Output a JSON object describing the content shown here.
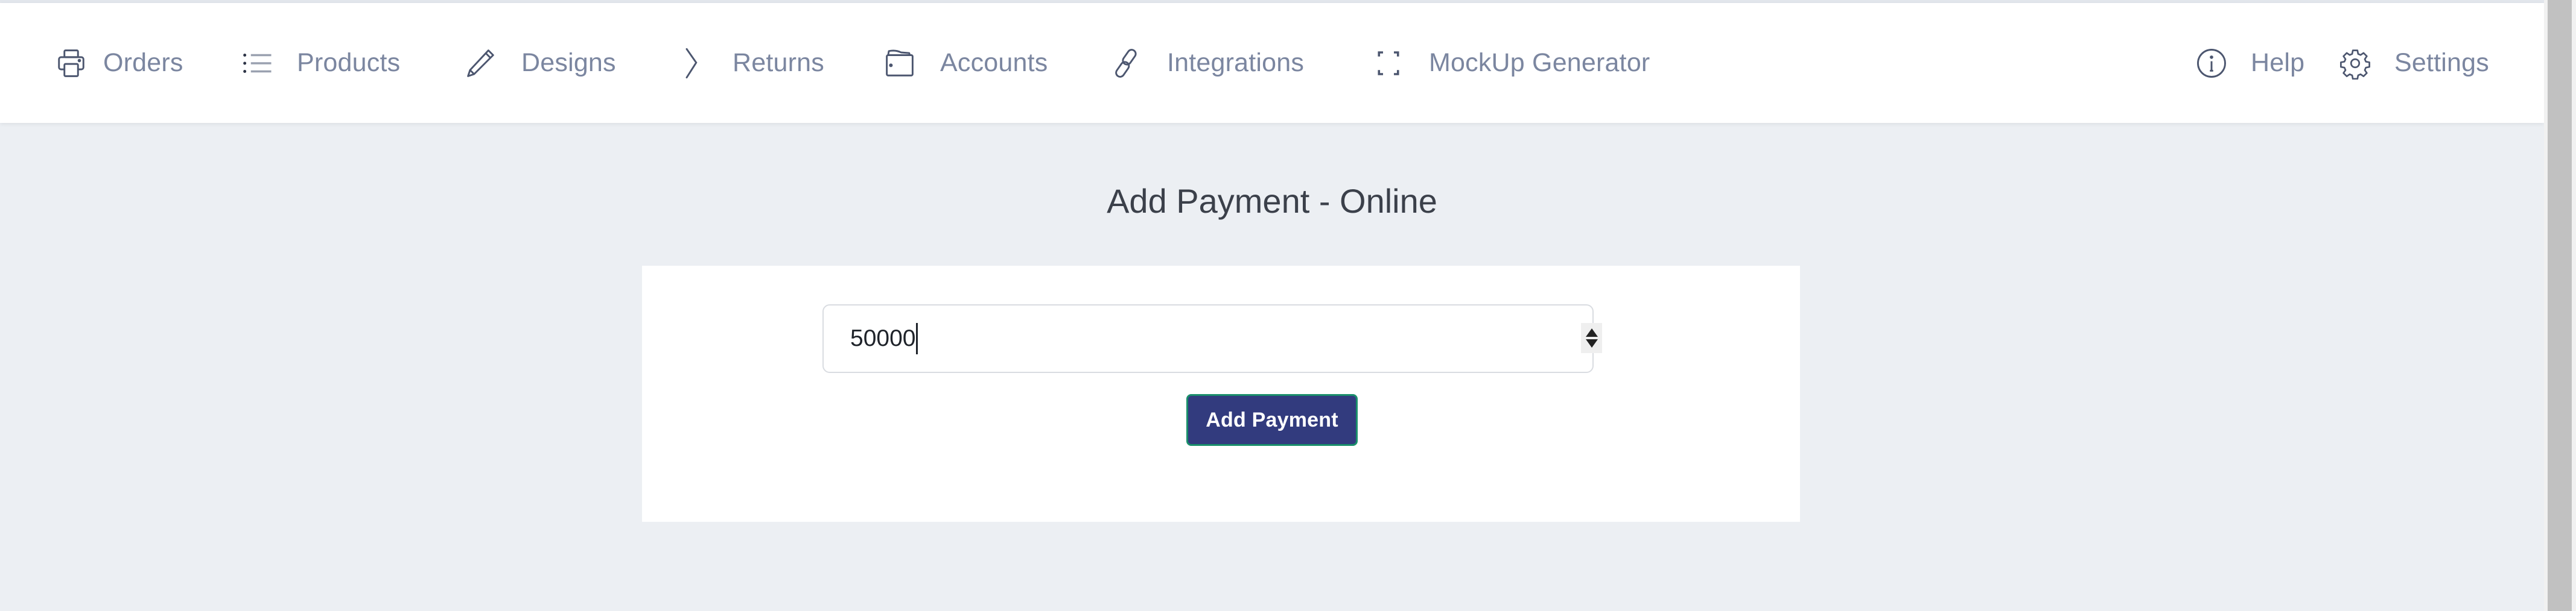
{
  "nav": {
    "left_items": [
      {
        "label": "Orders",
        "icon": "printer-icon"
      },
      {
        "label": "Products",
        "icon": "list-icon"
      },
      {
        "label": "Designs",
        "icon": "pencil-icon"
      },
      {
        "label": "Returns",
        "icon": "chevron-right-icon"
      },
      {
        "label": "Accounts",
        "icon": "wallet-icon"
      },
      {
        "label": "Integrations",
        "icon": "link-icon"
      },
      {
        "label": "MockUp Generator",
        "icon": "frame-corners-icon"
      }
    ],
    "right_items": [
      {
        "label": "Help",
        "icon": "info-circle-icon"
      },
      {
        "label": "Settings",
        "icon": "gear-icon"
      }
    ]
  },
  "main": {
    "title": "Add Payment - Online",
    "amount_input": {
      "value": "50000",
      "type": "number"
    },
    "submit_label": "Add Payment"
  },
  "colors": {
    "button_bg": "#323b7e",
    "button_border": "#1a8f6b",
    "page_bg": "#eceff3",
    "nav_text": "#7b86a0"
  }
}
